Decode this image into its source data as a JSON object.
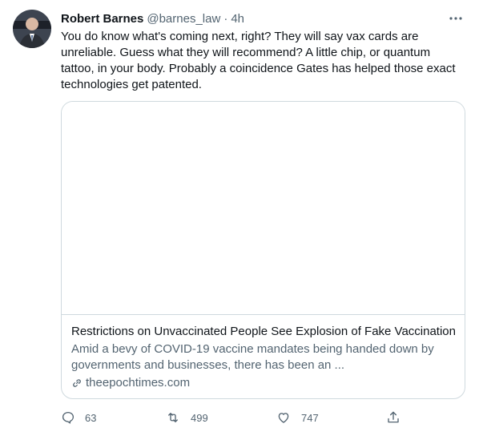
{
  "tweet": {
    "author_name": "Robert Barnes",
    "author_handle": "@barnes_law",
    "separator": "·",
    "time": "4h",
    "text": "You do know what's coming next, right? They will say vax cards are unreliable. Guess what they will recommend? A little chip, or quantum tattoo, in your body. Probably a coincidence Gates has helped those exact technologies get patented."
  },
  "card": {
    "title": "Restrictions on Unvaccinated People See Explosion of Fake Vaccination...",
    "description": "Amid a bevy of COVID-19 vaccine mandates being handed down by governments and businesses, there has been an ...",
    "domain": "theepochtimes.com"
  },
  "actions": {
    "replies": "63",
    "retweets": "499",
    "likes": "747"
  },
  "icons": {
    "more": "more-horizontal-icon",
    "reply": "reply-icon",
    "retweet": "retweet-icon",
    "like": "heart-icon",
    "share": "share-icon",
    "link": "link-icon"
  },
  "colors": {
    "text_primary": "#0f1419",
    "text_secondary": "#536471",
    "border": "#cfd9de"
  }
}
